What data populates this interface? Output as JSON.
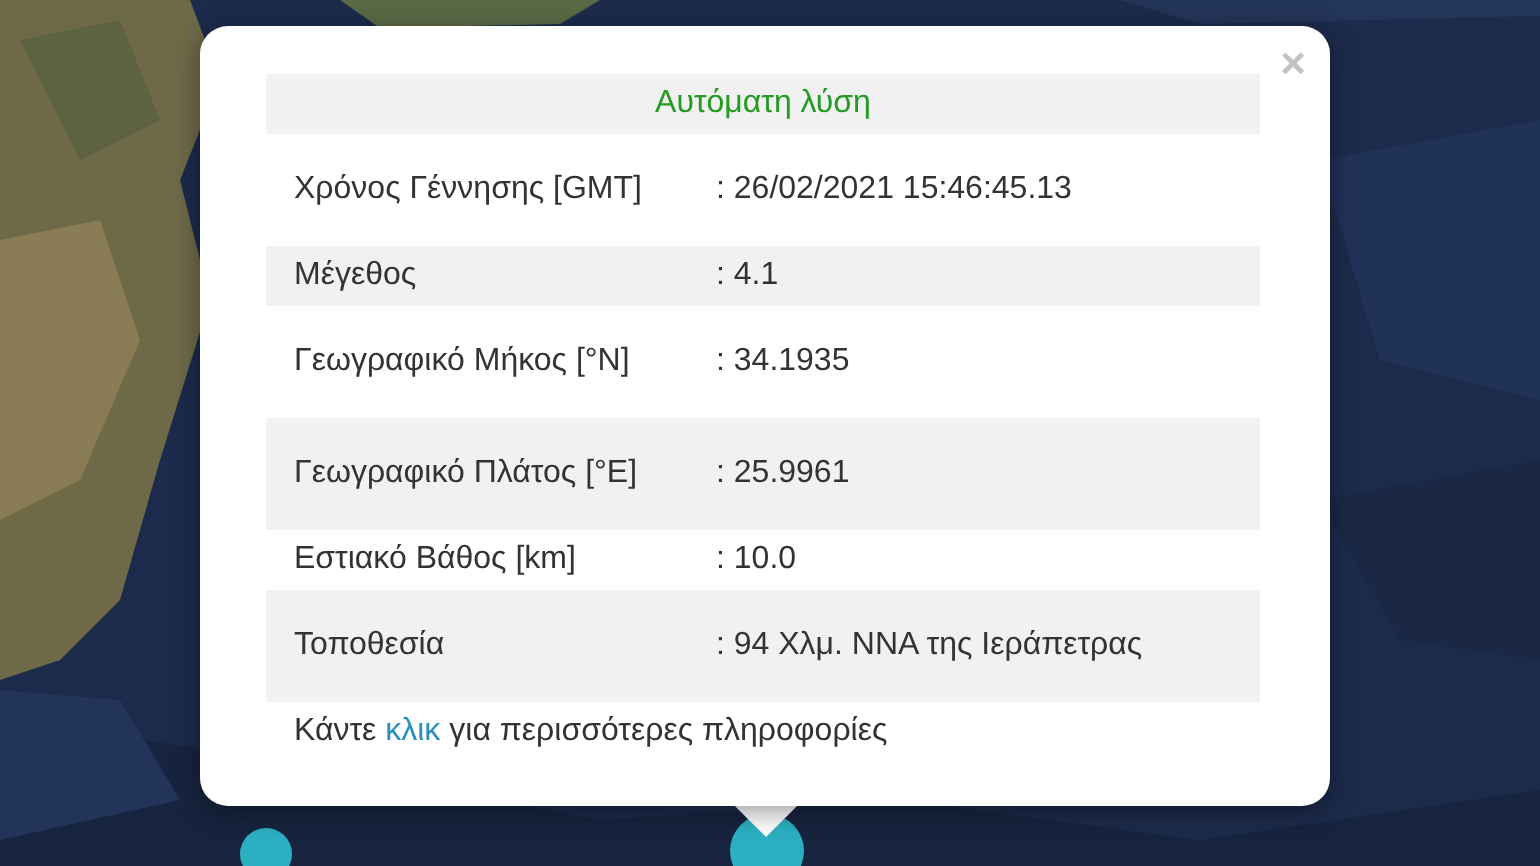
{
  "popup": {
    "close": "×",
    "title": "Αυτόματη λύση",
    "rows": [
      {
        "label": "Χρόνος Γέννησης [GMT]",
        "value": ": 26/02/2021 15:46:45.13"
      },
      {
        "label": "Μέγεθος",
        "value": ": 4.1"
      },
      {
        "label": "Γεωγραφικό Μήκος [°N]",
        "value": ": 34.1935"
      },
      {
        "label": "Γεωγραφικό Πλάτος [°E]",
        "value": ": 25.9961"
      },
      {
        "label": "Εστιακό Βάθος [km]",
        "value": ": 10.0"
      },
      {
        "label": "Τοποθεσία",
        "value": ": 94 Χλμ. ΝΝΑ της Ιεράπετρας"
      }
    ],
    "footer": {
      "before": "Κάντε ",
      "link": "κλικ",
      "after": " για περισσότερες πληροφορίες"
    }
  }
}
